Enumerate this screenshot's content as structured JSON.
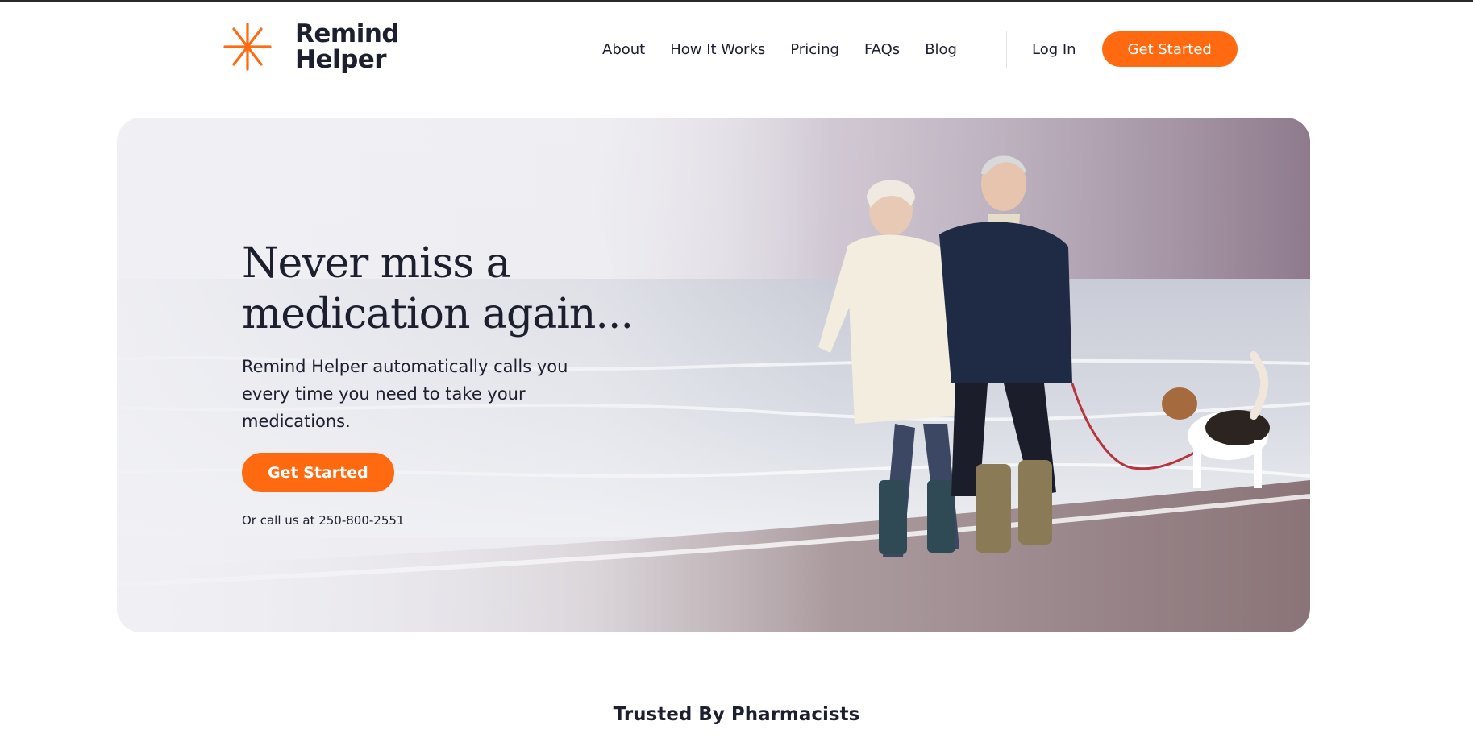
{
  "brand": {
    "name_line1": "Remind",
    "name_line2": "Helper",
    "accent_color": "#ff6a10",
    "logo_icon": "asterisk-star-icon"
  },
  "nav": {
    "links": [
      "About",
      "How It Works",
      "Pricing",
      "FAQs",
      "Blog"
    ],
    "login_label": "Log In",
    "cta_label": "Get Started"
  },
  "hero": {
    "title_line1": "Never miss a",
    "title_line2": "medication again...",
    "subtitle": "Remind Helper automatically calls you every time you need to take your medications.",
    "cta_label": "Get Started",
    "call_text": "Or call us at 250-800-2551",
    "image": "photo-senior-couple-walking-dog-on-beach"
  },
  "trusted": {
    "heading": "Trusted By Pharmacists"
  }
}
